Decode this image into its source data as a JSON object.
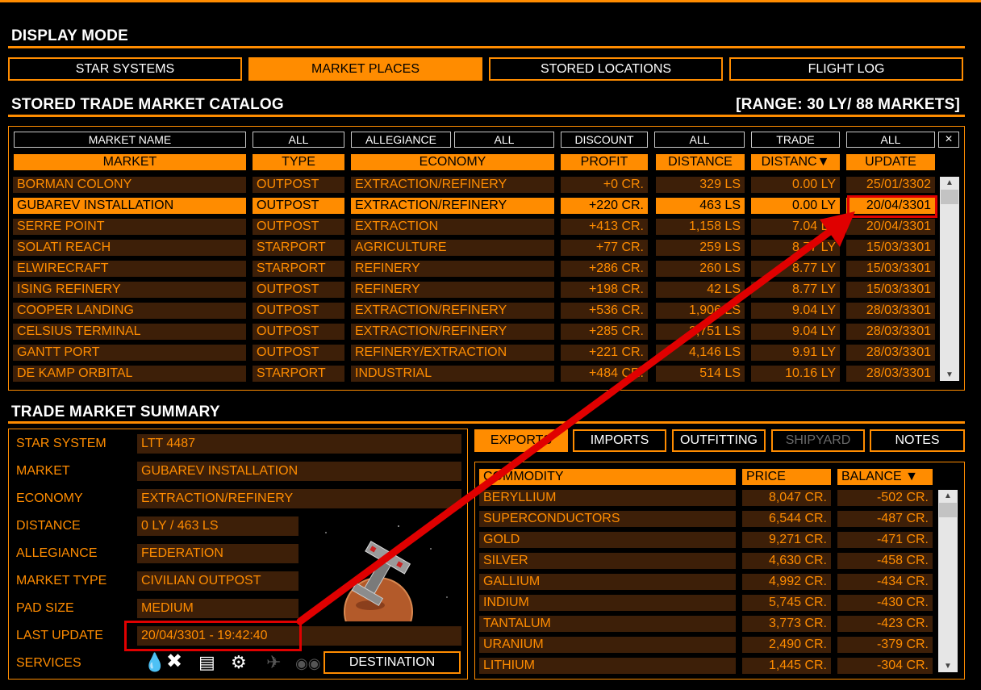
{
  "display_mode": {
    "title": "DISPLAY MODE",
    "tabs": [
      {
        "label": "STAR SYSTEMS",
        "active": false
      },
      {
        "label": "MARKET PLACES",
        "active": true
      },
      {
        "label": "STORED LOCATIONS",
        "active": false
      },
      {
        "label": "FLIGHT LOG",
        "active": false
      }
    ]
  },
  "catalog": {
    "title": "STORED TRADE MARKET CATALOG",
    "range": "[RANGE: 30 LY/ 88 MARKETS]",
    "filters": {
      "market_name": "MARKET NAME",
      "type": "ALL",
      "allegiance": "ALLEGIANCE",
      "economy": "ALL",
      "discount": "DISCOUNT",
      "distance": "ALL",
      "trade": "TRADE",
      "update": "ALL",
      "clear": "×"
    },
    "columns": [
      "MARKET",
      "TYPE",
      "ECONOMY",
      "PROFIT",
      "DISTANCE",
      "DISTANC▼",
      "UPDATE"
    ],
    "rows": [
      {
        "market": "BORMAN COLONY",
        "type": "OUTPOST",
        "economy": "EXTRACTION/REFINERY",
        "profit": "+0 CR.",
        "distance": "329 LS",
        "distly": "0.00 LY",
        "update": "25/01/3302"
      },
      {
        "market": "GUBAREV INSTALLATION",
        "type": "OUTPOST",
        "economy": "EXTRACTION/REFINERY",
        "profit": "+220 CR.",
        "distance": "463 LS",
        "distly": "0.00 LY",
        "update": "20/04/3301"
      },
      {
        "market": "SERRE POINT",
        "type": "OUTPOST",
        "economy": "EXTRACTION",
        "profit": "+413 CR.",
        "distance": "1,158 LS",
        "distly": "7.04 LY",
        "update": "20/04/3301"
      },
      {
        "market": "SOLATI REACH",
        "type": "STARPORT",
        "economy": "AGRICULTURE",
        "profit": "+77 CR.",
        "distance": "259 LS",
        "distly": "8.77 LY",
        "update": "15/03/3301"
      },
      {
        "market": "ELWIRECRAFT",
        "type": "STARPORT",
        "economy": "REFINERY",
        "profit": "+286 CR.",
        "distance": "260 LS",
        "distly": "8.77 LY",
        "update": "15/03/3301"
      },
      {
        "market": "ISING REFINERY",
        "type": "OUTPOST",
        "economy": "REFINERY",
        "profit": "+198 CR.",
        "distance": "42 LS",
        "distly": "8.77 LY",
        "update": "15/03/3301"
      },
      {
        "market": "COOPER LANDING",
        "type": "OUTPOST",
        "economy": "EXTRACTION/REFINERY",
        "profit": "+536 CR.",
        "distance": "1,906 LS",
        "distly": "9.04 LY",
        "update": "28/03/3301"
      },
      {
        "market": "CELSIUS TERMINAL",
        "type": "OUTPOST",
        "economy": "EXTRACTION/REFINERY",
        "profit": "+285 CR.",
        "distance": "2,751 LS",
        "distly": "9.04 LY",
        "update": "28/03/3301"
      },
      {
        "market": "GANTT PORT",
        "type": "OUTPOST",
        "economy": "REFINERY/EXTRACTION",
        "profit": "+221 CR.",
        "distance": "4,146 LS",
        "distly": "9.91 LY",
        "update": "28/03/3301"
      },
      {
        "market": "DE KAMP ORBITAL",
        "type": "STARPORT",
        "economy": "INDUSTRIAL",
        "profit": "+484 CR.",
        "distance": "514 LS",
        "distly": "10.16 LY",
        "update": "28/03/3301"
      }
    ],
    "selected_row": 1
  },
  "summary": {
    "title": "TRADE MARKET SUMMARY",
    "fields": [
      {
        "label": "STAR SYSTEM",
        "value": "LTT 4487"
      },
      {
        "label": "MARKET",
        "value": "GUBAREV INSTALLATION"
      },
      {
        "label": "ECONOMY",
        "value": "EXTRACTION/REFINERY"
      },
      {
        "label": "DISTANCE",
        "value": "0 LY / 463 LS"
      },
      {
        "label": "ALLEGIANCE",
        "value": "FEDERATION"
      },
      {
        "label": "MARKET TYPE",
        "value": "CIVILIAN OUTPOST"
      },
      {
        "label": "PAD SIZE",
        "value": "MEDIUM"
      },
      {
        "label": "LAST UPDATE",
        "value": "20/04/3301 - 19:42:40"
      }
    ],
    "services_label": "SERVICES",
    "services_icons": [
      "refuel-icon",
      "repair-icon",
      "rearm-icon",
      "outfitting-icon",
      "shipyard-icon",
      "black-market-icon"
    ],
    "destination_button": "DESTINATION"
  },
  "market_tabs": [
    {
      "label": "EXPORTS",
      "state": "active"
    },
    {
      "label": "IMPORTS",
      "state": "normal"
    },
    {
      "label": "OUTFITTING",
      "state": "normal"
    },
    {
      "label": "SHIPYARD",
      "state": "disabled"
    },
    {
      "label": "NOTES",
      "state": "normal"
    }
  ],
  "commodities": {
    "columns": [
      "COMMODITY",
      "PRICE",
      "BALANCE ▼"
    ],
    "rows": [
      {
        "name": "BERYLLIUM",
        "price": "8,047 CR.",
        "balance": "-502 CR."
      },
      {
        "name": "SUPERCONDUCTORS",
        "price": "6,544 CR.",
        "balance": "-487 CR."
      },
      {
        "name": "GOLD",
        "price": "9,271 CR.",
        "balance": "-471 CR."
      },
      {
        "name": "SILVER",
        "price": "4,630 CR.",
        "balance": "-458 CR."
      },
      {
        "name": "GALLIUM",
        "price": "4,992 CR.",
        "balance": "-434 CR."
      },
      {
        "name": "INDIUM",
        "price": "5,745 CR.",
        "balance": "-430 CR."
      },
      {
        "name": "TANTALUM",
        "price": "3,773 CR.",
        "balance": "-423 CR."
      },
      {
        "name": "URANIUM",
        "price": "2,490 CR.",
        "balance": "-379 CR."
      },
      {
        "name": "LITHIUM",
        "price": "1,445 CR.",
        "balance": "-304 CR."
      }
    ]
  },
  "colors": {
    "accent": "#ff8c00",
    "row_bg": "#3d1f08",
    "annotation": "#e00000"
  }
}
